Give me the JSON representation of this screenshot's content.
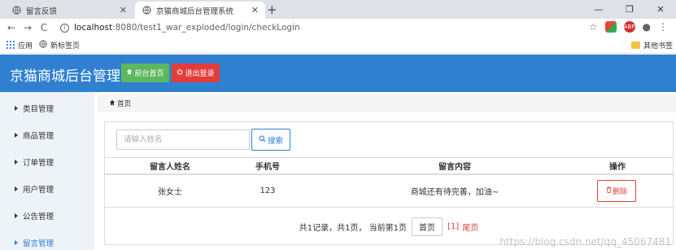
{
  "browser": {
    "tabs": [
      {
        "title": "留言反馈",
        "active": false
      },
      {
        "title": "京猫商城后台管理系统",
        "active": true
      }
    ],
    "new_tab": "+",
    "window_controls": [
      "—",
      "❐",
      "✕"
    ],
    "nav": {
      "back": "←",
      "forward": "→",
      "reload": "C"
    },
    "url_host": "localhost",
    "url_path": ":8080/test1_war_exploded/login/checkLogin",
    "bookmarks": [
      "应用",
      "新标签页"
    ],
    "other_bookmarks": "其他书签",
    "extensions": [
      "ABP"
    ]
  },
  "header": {
    "brand": "京猫商城后台管理",
    "home_label": "前台首页",
    "logout_label": "退出登录"
  },
  "sidebar": {
    "items": [
      {
        "label": "类目管理"
      },
      {
        "label": "商品管理"
      },
      {
        "label": "订单管理"
      },
      {
        "label": "用户管理"
      },
      {
        "label": "公告管理"
      },
      {
        "label": "留言管理"
      }
    ],
    "active_index": 5
  },
  "breadcrumb": "首页",
  "search": {
    "placeholder": "请输入姓名",
    "button_label": "搜索"
  },
  "table": {
    "columns": [
      "留言人姓名",
      "手机号",
      "留言内容",
      "操作"
    ],
    "rows": [
      {
        "name": "张女士",
        "phone": "123",
        "content": "商城还有待完善，加油~",
        "action": "删除"
      }
    ]
  },
  "pagination": {
    "info": "共1记录，共1页， 当前第1页",
    "first": "首页",
    "current": "[1]",
    "last": "尾页"
  },
  "watermark": "https://blog.csdn.net/qq_45067481",
  "colors": {
    "header_bg": "#2f80d1",
    "home_btn": "#5cb85c",
    "logout_btn": "#e33d3a",
    "sidebar_bg": "#eef3f8",
    "active_link": "#2f80d1"
  }
}
